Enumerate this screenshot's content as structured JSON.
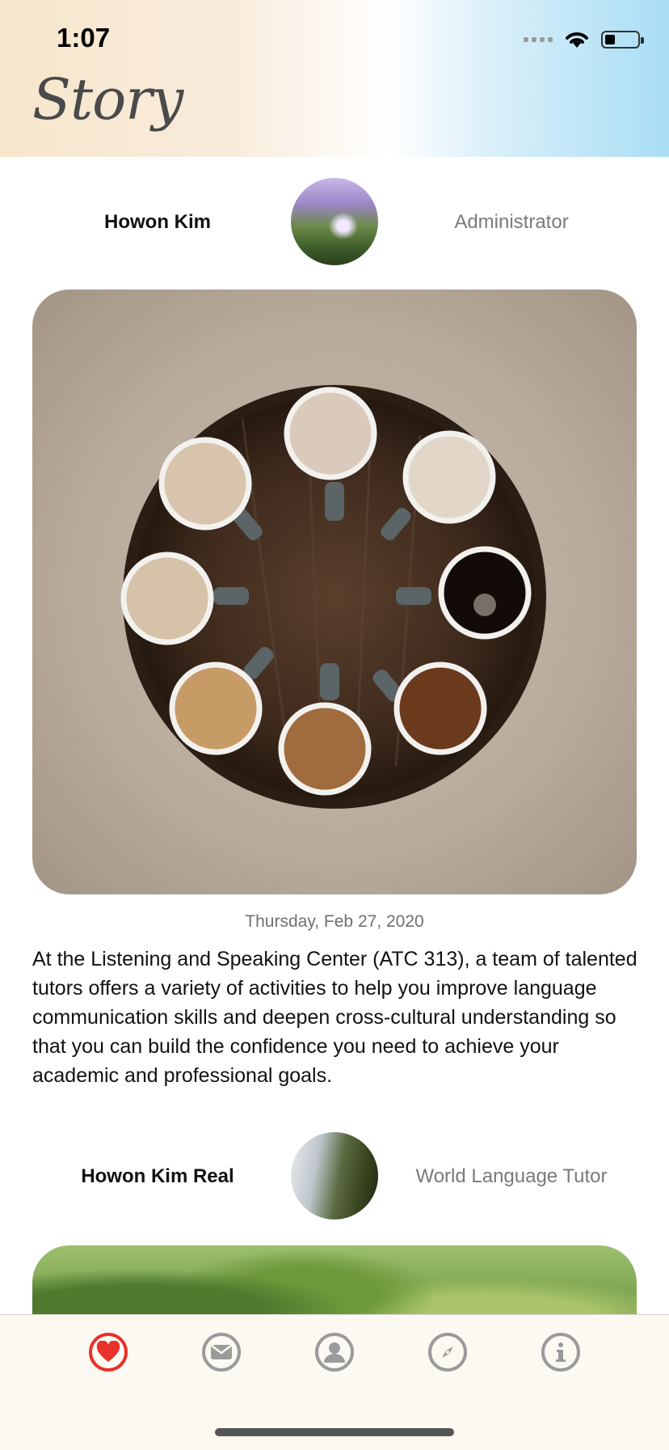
{
  "status_bar": {
    "time": "1:07",
    "battery_level": 0.25
  },
  "header": {
    "title": "Story"
  },
  "posts": [
    {
      "author": "Howon Kim",
      "role": "Administrator",
      "avatar": "waterfall-purple-avatar",
      "date": "Thursday, Feb 27, 2020",
      "body": "At the Listening and Speaking Center (ATC 313), a team of talented tutors offers a variety of activities to help you improve language communication skills and deepen cross-cultural understanding so that you can build the confidence you need to achieve your academic and professional goals.",
      "image": "coffee-cups-on-wooden-stool"
    },
    {
      "author": "Howon Kim Real",
      "role": "World Language Tutor",
      "avatar": "waterfall-rocks-avatar",
      "image": "green-leaves"
    }
  ],
  "tabbar": {
    "items": [
      {
        "name": "heart-icon",
        "active": true
      },
      {
        "name": "mail-icon",
        "active": false
      },
      {
        "name": "user-icon",
        "active": false
      },
      {
        "name": "compass-icon",
        "active": false
      },
      {
        "name": "info-icon",
        "active": false
      }
    ],
    "accent_color": "#e8312a",
    "inactive_color": "#9a9a9a"
  }
}
